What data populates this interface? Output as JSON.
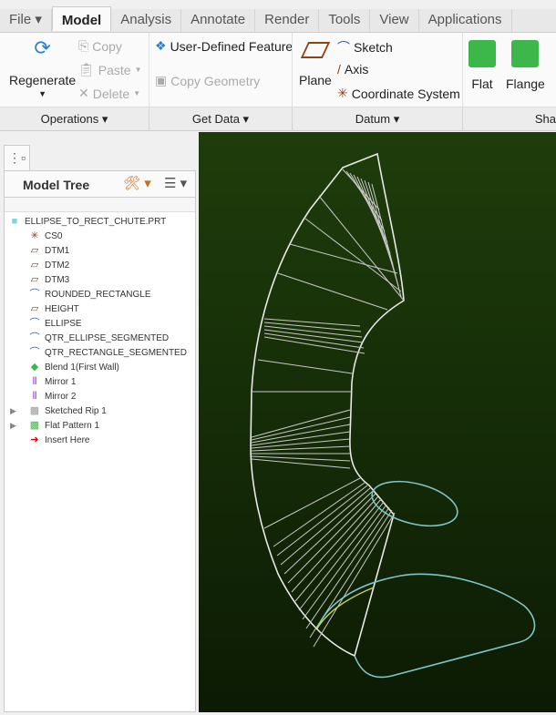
{
  "tabs": [
    "File",
    "Model",
    "Analysis",
    "Annotate",
    "Render",
    "Tools",
    "View",
    "Applications"
  ],
  "ribbon": {
    "regenerate": "Regenerate",
    "copy": "Copy",
    "paste": "Paste",
    "delete": "Delete",
    "udf": "User-Defined Feature",
    "copy_geometry": "Copy Geometry",
    "plane": "Plane",
    "sketch": "Sketch",
    "axis": "Axis",
    "coordinate_system": "Coordinate System",
    "flat": "Flat",
    "flange": "Flange"
  },
  "groups": [
    "Operations",
    "Get Data",
    "Datum",
    "Sha"
  ],
  "tree": {
    "title": "Model Tree",
    "items": [
      {
        "label": "ELLIPSE_TO_RECT_CHUTE.PRT",
        "icon": "part-icon"
      },
      {
        "label": "CS0",
        "icon": "csys-icon"
      },
      {
        "label": "DTM1",
        "icon": "plane-icon"
      },
      {
        "label": "DTM2",
        "icon": "plane-icon"
      },
      {
        "label": "DTM3",
        "icon": "plane-icon"
      },
      {
        "label": "ROUNDED_RECTANGLE",
        "icon": "sketch-icon"
      },
      {
        "label": "HEIGHT",
        "icon": "plane-icon"
      },
      {
        "label": "ELLIPSE",
        "icon": "sketch-icon"
      },
      {
        "label": "QTR_ELLIPSE_SEGMENTED",
        "icon": "sketch-icon"
      },
      {
        "label": "QTR_RECTANGLE_SEGMENTED",
        "icon": "sketch-icon"
      },
      {
        "label": "Blend 1(First Wall)",
        "icon": "blend-icon"
      },
      {
        "label": "Mirror 1",
        "icon": "mirror-icon"
      },
      {
        "label": "Mirror 2",
        "icon": "mirror-icon"
      },
      {
        "label": "Sketched Rip 1",
        "icon": "rip-icon"
      },
      {
        "label": "Flat Pattern 1",
        "icon": "flat-pattern-icon"
      },
      {
        "label": "Insert Here",
        "icon": "insert-arrow-icon"
      }
    ]
  }
}
